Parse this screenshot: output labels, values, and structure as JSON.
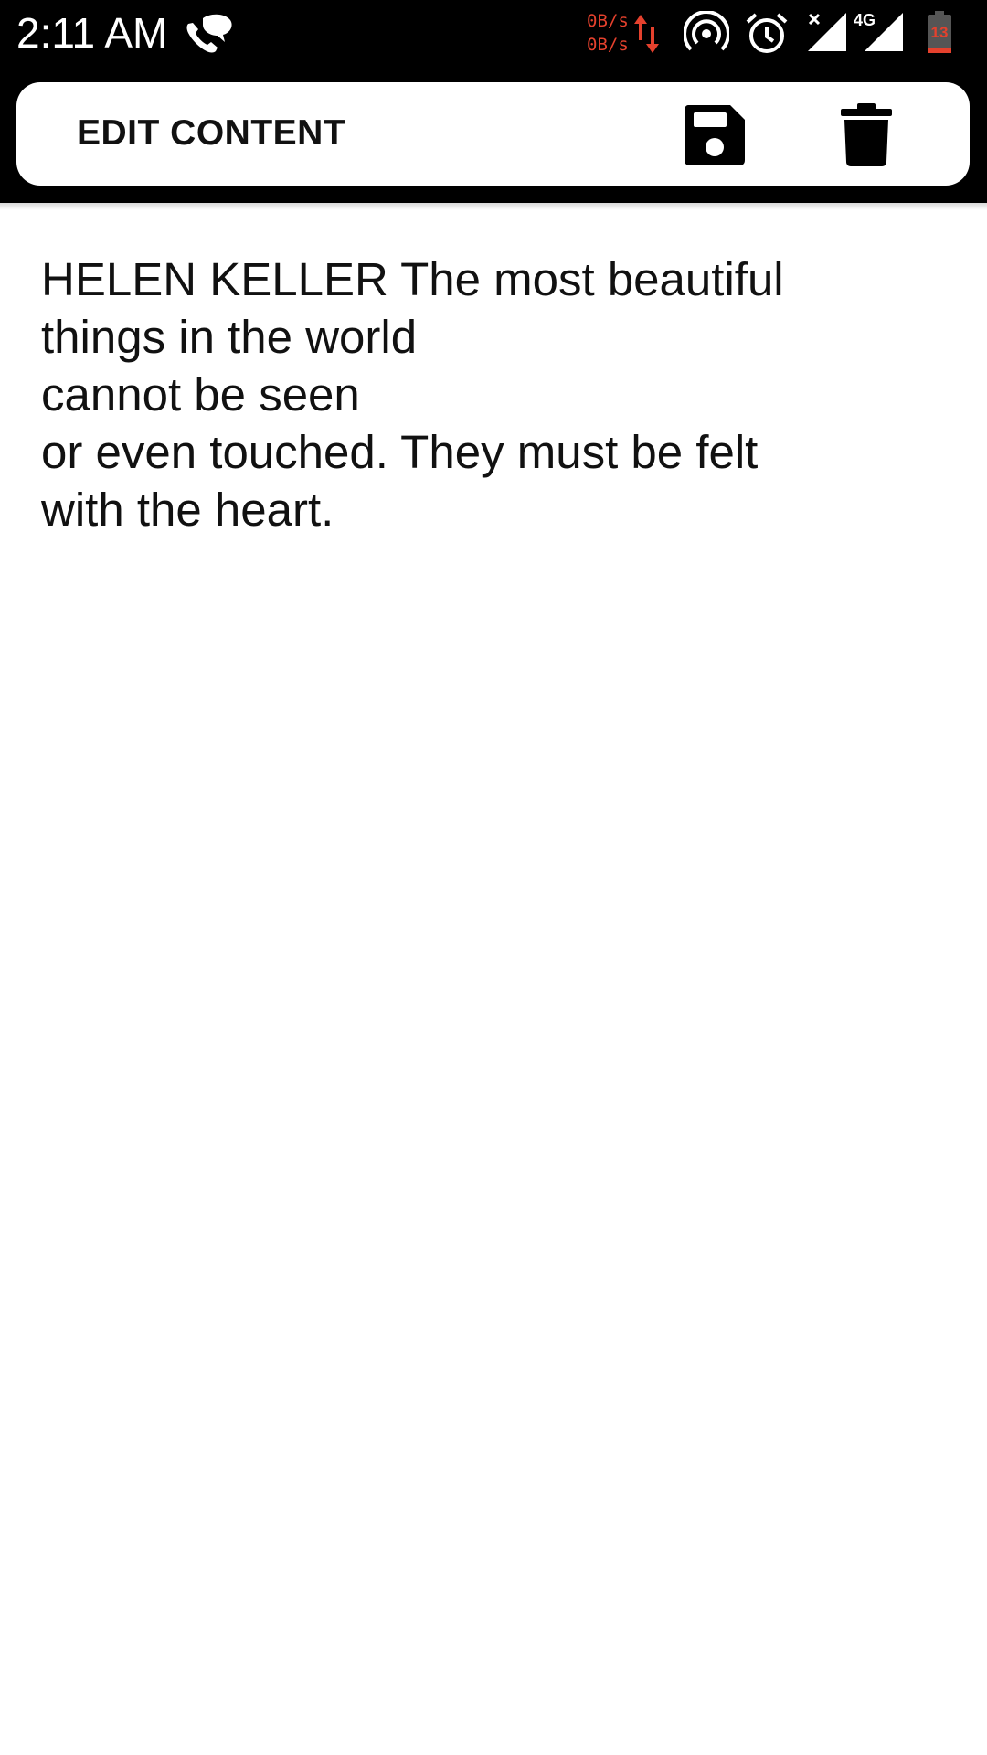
{
  "status_bar": {
    "time": "2:11 AM",
    "net_up": "0B/s",
    "net_down": "0B/s",
    "network_type": "4G",
    "battery_level": "13",
    "icons": [
      "phone-chat-icon",
      "data-arrows-icon",
      "hotspot-icon",
      "alarm-icon",
      "signal-x-icon",
      "signal-icon",
      "battery-icon"
    ],
    "accent_color": "#e5412d"
  },
  "toolbar": {
    "title": "EDIT CONTENT",
    "save_icon": "save-icon",
    "delete_icon": "trash-icon"
  },
  "content": {
    "text": "HELEN KELLER The most beautiful\nthings in the world\ncannot be seen\nor even touched. They must be felt\nwith the heart."
  }
}
